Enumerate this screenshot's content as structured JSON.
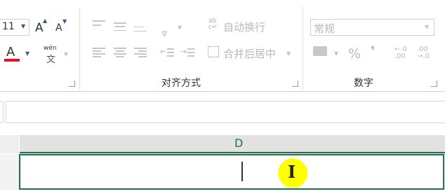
{
  "font_group": {
    "font_size": "11",
    "grow_font": "A",
    "shrink_font": "A",
    "font_color_letter": "A",
    "phonetic_top": "wén",
    "phonetic_char": "文"
  },
  "alignment_group": {
    "label": "对齐方式",
    "wrap_text": "自动换行",
    "merge_center": "合并后居中"
  },
  "number_group": {
    "label": "数字",
    "format_value": "常规",
    "percent": "%",
    "comma": "❜",
    "inc_decimal_top": "←.0",
    "inc_decimal_bottom": ".00",
    "dec_decimal_top": ".00",
    "dec_decimal_bottom": "→.0"
  },
  "sheet": {
    "column_header": "D",
    "cursor_glyph": "I"
  },
  "colors": {
    "accent_green": "#217346",
    "font_color_red": "#e81123",
    "highlight_yellow": "#ffff00",
    "icon_blue": "#2b579a"
  }
}
